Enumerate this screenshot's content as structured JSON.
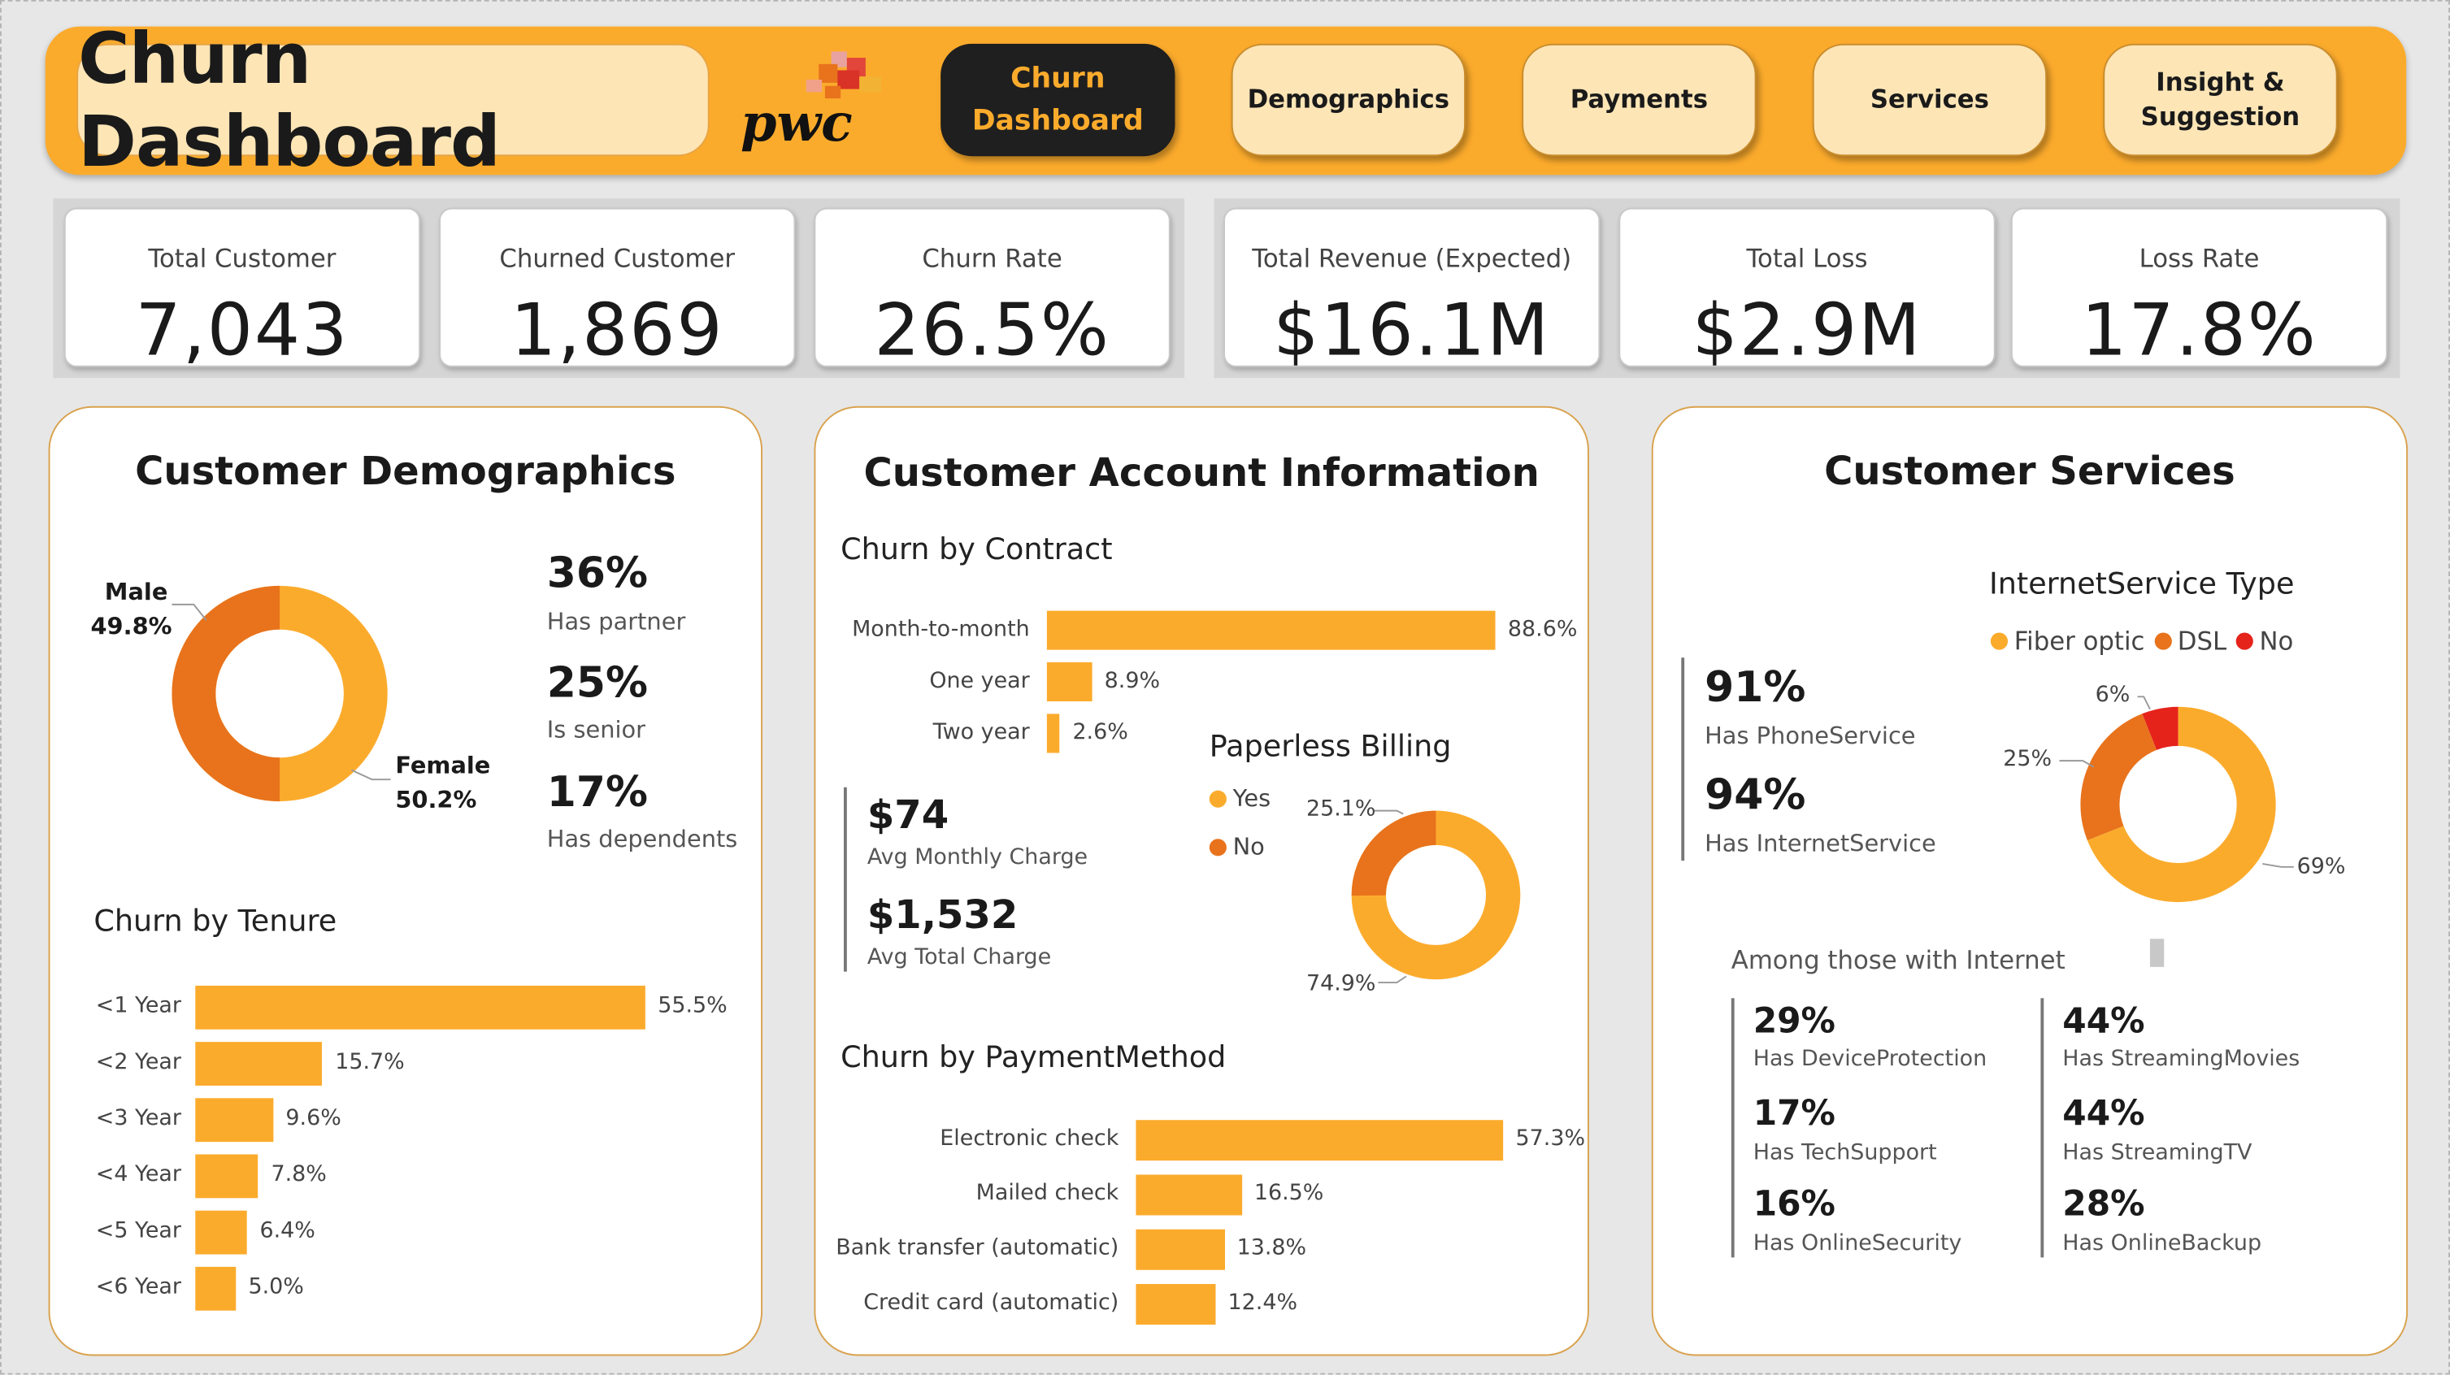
{
  "header": {
    "title": "Churn Dashboard",
    "logo_text": "pwc",
    "nav": [
      {
        "label": "Churn\nDashboard",
        "active": true
      },
      {
        "label": "Demographics",
        "active": false
      },
      {
        "label": "Payments",
        "active": false
      },
      {
        "label": "Services",
        "active": false
      },
      {
        "label": "Insight &\nSuggestion",
        "active": false
      }
    ]
  },
  "kpis": [
    {
      "label": "Total Customer",
      "value": "7,043"
    },
    {
      "label": "Churned Customer",
      "value": "1,869"
    },
    {
      "label": "Churn Rate",
      "value": "26.5%"
    },
    {
      "label": "Total Revenue (Expected)",
      "value": "$16.1M"
    },
    {
      "label": "Total Loss",
      "value": "$2.9M"
    },
    {
      "label": "Loss Rate",
      "value": "17.8%"
    }
  ],
  "demographics": {
    "title": "Customer Demographics",
    "gender": {
      "male_label": "Male",
      "male_pct": "49.8%",
      "male_value": 49.8,
      "female_label": "Female",
      "female_pct": "50.2%",
      "female_value": 50.2
    },
    "stats": [
      {
        "value": "36%",
        "label": "Has partner"
      },
      {
        "value": "25%",
        "label": "Is senior"
      },
      {
        "value": "17%",
        "label": "Has dependents"
      }
    ],
    "tenure_title": "Churn by Tenure"
  },
  "account": {
    "title": "Customer Account Information",
    "contract_title": "Churn by Contract",
    "avg_monthly": {
      "value": "$74",
      "label": "Avg Monthly Charge"
    },
    "avg_total": {
      "value": "$1,532",
      "label": "Avg Total Charge"
    },
    "paperless": {
      "title": "Paperless Billing",
      "yes_label": "Yes",
      "no_label": "No",
      "yes_pct": "74.9%",
      "no_pct": "25.1%",
      "yes_value": 74.9,
      "no_value": 25.1
    },
    "payment_title": "Churn by PaymentMethod"
  },
  "services": {
    "title": "Customer Services",
    "phone": {
      "value": "91%",
      "label": "Has PhoneService"
    },
    "internet": {
      "value": "94%",
      "label": "Has InternetService"
    },
    "internet_type": {
      "title": "InternetService Type",
      "legend": [
        "Fiber optic",
        "DSL",
        "No"
      ],
      "pct_labels": [
        "69%",
        "25%",
        "6%"
      ],
      "values": [
        69,
        25,
        6
      ]
    },
    "among_title": "Among those with Internet",
    "among": [
      {
        "value": "29%",
        "label": "Has DeviceProtection"
      },
      {
        "value": "17%",
        "label": "Has TechSupport"
      },
      {
        "value": "16%",
        "label": "Has OnlineSecurity"
      },
      {
        "value": "44%",
        "label": "Has StreamingMovies"
      },
      {
        "value": "44%",
        "label": "Has StreamingTV"
      },
      {
        "value": "28%",
        "label": "Has OnlineBackup"
      }
    ]
  },
  "colors": {
    "orange": "#fbab2c",
    "dark_orange": "#e8731c",
    "red": "#e5231b",
    "dark": "#1f1f1f",
    "cream": "#fde5b6"
  },
  "chart_data": [
    {
      "type": "bar",
      "orientation": "horizontal",
      "title": "Churn by Tenure",
      "categories": [
        "<1 Year",
        "<2 Year",
        "<3 Year",
        "<4 Year",
        "<5 Year",
        "<6 Year"
      ],
      "values": [
        55.5,
        15.7,
        9.6,
        7.8,
        6.4,
        5.0
      ],
      "value_labels": [
        "55.5%",
        "15.7%",
        "9.6%",
        "7.8%",
        "6.4%",
        "5.0%"
      ]
    },
    {
      "type": "bar",
      "orientation": "horizontal",
      "title": "Churn by Contract",
      "categories": [
        "Month-to-month",
        "One year",
        "Two year"
      ],
      "values": [
        88.6,
        8.9,
        2.6
      ],
      "value_labels": [
        "88.6%",
        "8.9%",
        "2.6%"
      ]
    },
    {
      "type": "bar",
      "orientation": "horizontal",
      "title": "Churn by PaymentMethod",
      "categories": [
        "Electronic check",
        "Mailed check",
        "Bank transfer (automatic)",
        "Credit card (automatic)"
      ],
      "values": [
        57.3,
        16.5,
        13.8,
        12.4
      ],
      "value_labels": [
        "57.3%",
        "16.5%",
        "13.8%",
        "12.4%"
      ]
    }
  ]
}
